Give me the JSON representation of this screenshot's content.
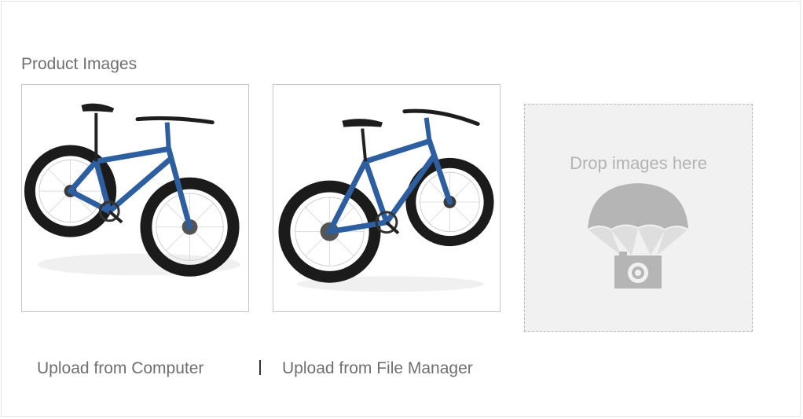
{
  "section": {
    "title": "Product Images"
  },
  "images": [
    {
      "name": "bike-image-1",
      "color": "#2d5fa0"
    },
    {
      "name": "bike-image-2",
      "color": "#2d5fa0"
    }
  ],
  "dropzone": {
    "label": "Drop images here",
    "icon": "parachute-camera-icon"
  },
  "actions": {
    "upload_computer": "Upload from Computer",
    "upload_file_manager": "Upload from File Manager"
  }
}
